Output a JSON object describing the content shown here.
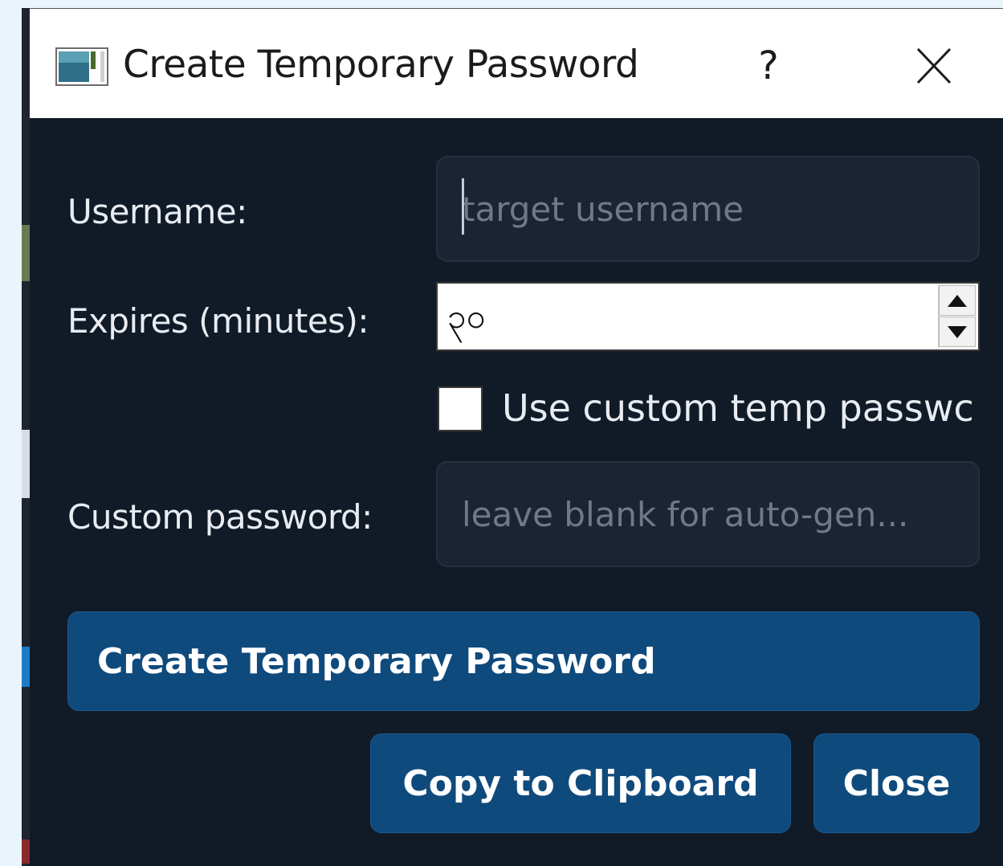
{
  "window": {
    "title": "Create Temporary Password",
    "help_label": "?",
    "icon": "app-window-icon",
    "close_icon": "close-icon"
  },
  "form": {
    "username": {
      "label": "Username:",
      "value": "",
      "placeholder": "target username"
    },
    "expires": {
      "label": "Expires (minutes):",
      "value": "၃၀"
    },
    "custom_checkbox": {
      "label": "Use custom temp passwc",
      "checked": false
    },
    "custom_password": {
      "label": "Custom password:",
      "value": "",
      "placeholder": "leave blank for auto-gen..."
    }
  },
  "buttons": {
    "create": "Create Temporary Password",
    "copy": "Copy to Clipboard",
    "close": "Close"
  },
  "colors": {
    "dialog_bg": "#111b27",
    "button_bg": "#0f4a7d",
    "field_bg": "#1b2433",
    "page_bg": "#eaf4fc"
  }
}
